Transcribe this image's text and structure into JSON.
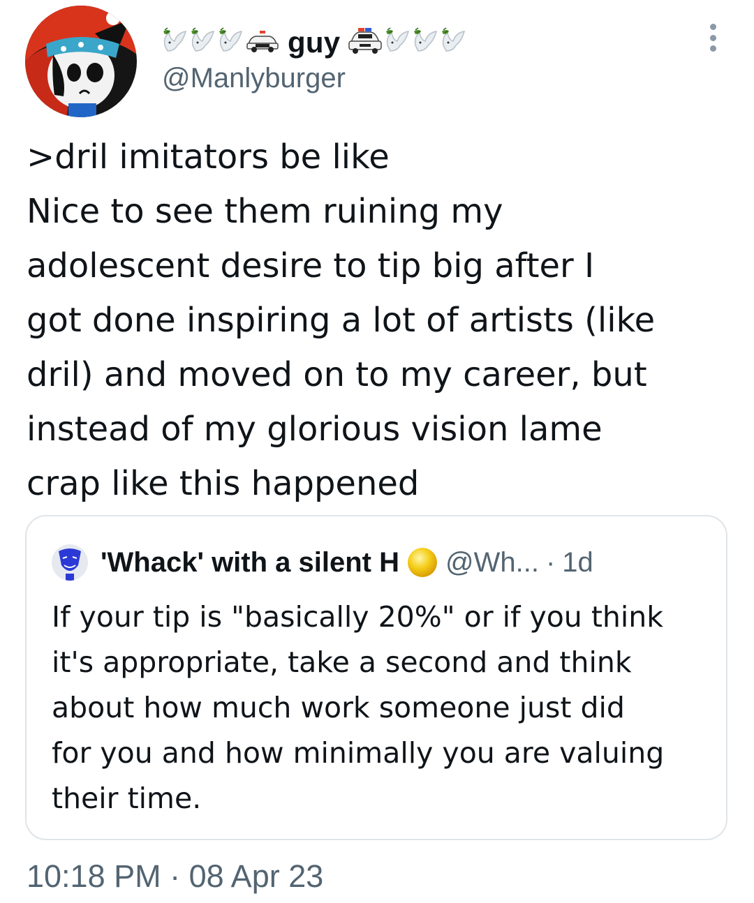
{
  "tweet": {
    "author": {
      "display_name": "guy",
      "handle": "@Manlyburger",
      "name_emojis_left": [
        "dove-icon",
        "dove-icon",
        "dove-icon",
        "police-car-icon"
      ],
      "name_emojis_right": [
        "police-car-icon",
        "dove-icon",
        "dove-icon",
        "dove-icon"
      ]
    },
    "text_lines": [
      ">dril imitators be like",
      "Nice to see them ruining my",
      "adolescent desire to tip big after I",
      "got done inspiring a lot of artists (like",
      "dril) and moved on to my career, but",
      "instead of my glorious vision lame",
      "crap like this happened"
    ],
    "timestamp": "10:18 PM · 08 Apr 23"
  },
  "quote": {
    "author": {
      "display_name": "'Whack' with a silent H",
      "handle": "@Wh...",
      "separator": "·",
      "time": "1d"
    },
    "text_lines": [
      "If your tip is \"basically 20%\" or if you think",
      "it's appropriate, take a second and think",
      "about how much work someone just did",
      "for you and how minimally you are valuing",
      "their time."
    ]
  },
  "colors": {
    "text_primary": "#0f1419",
    "text_secondary": "#536471",
    "border": "#dfe4e8",
    "badge_yellow": "#f2c40f"
  }
}
